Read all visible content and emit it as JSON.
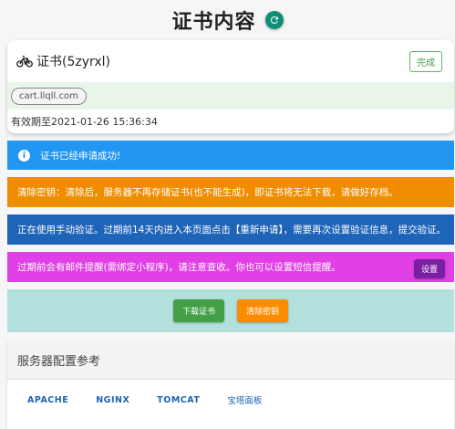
{
  "page": {
    "title": "证书内容"
  },
  "cert": {
    "title": "证书(5zyrxl)",
    "status_label": "完成",
    "domain": "cart.llqll.com",
    "expire_text": "有效期至2021-01-26 15:36:34"
  },
  "banners": {
    "success": "证书已经申请成功!",
    "warning": "清除密钥：清除后，服务器不再存储证书(也不能生成)，即证书将无法下载，请做好存档。",
    "manual": "正在使用手动验证。过期前14天内进入本页面点击【重新申请】，需要再次设置验证信息，提交验证。",
    "remind": "过期前会有邮件提醒(需绑定小程序)，请注意查收。你也可以设置短信提醒。",
    "settings_label": "设置"
  },
  "actions": {
    "download_label": "下载证书",
    "clear_label": "清除密钥"
  },
  "server": {
    "title": "服务器配置参考",
    "tabs": [
      "APACHE",
      "NGINX",
      "TOMCAT",
      "宝塔面板"
    ]
  },
  "colors": {
    "refresh": "#0e8f75",
    "success": "#2196f3",
    "warning": "#f08c00",
    "manual": "#1e64b9",
    "remind": "#e040e5",
    "actions_bg": "#b2e0dd"
  }
}
